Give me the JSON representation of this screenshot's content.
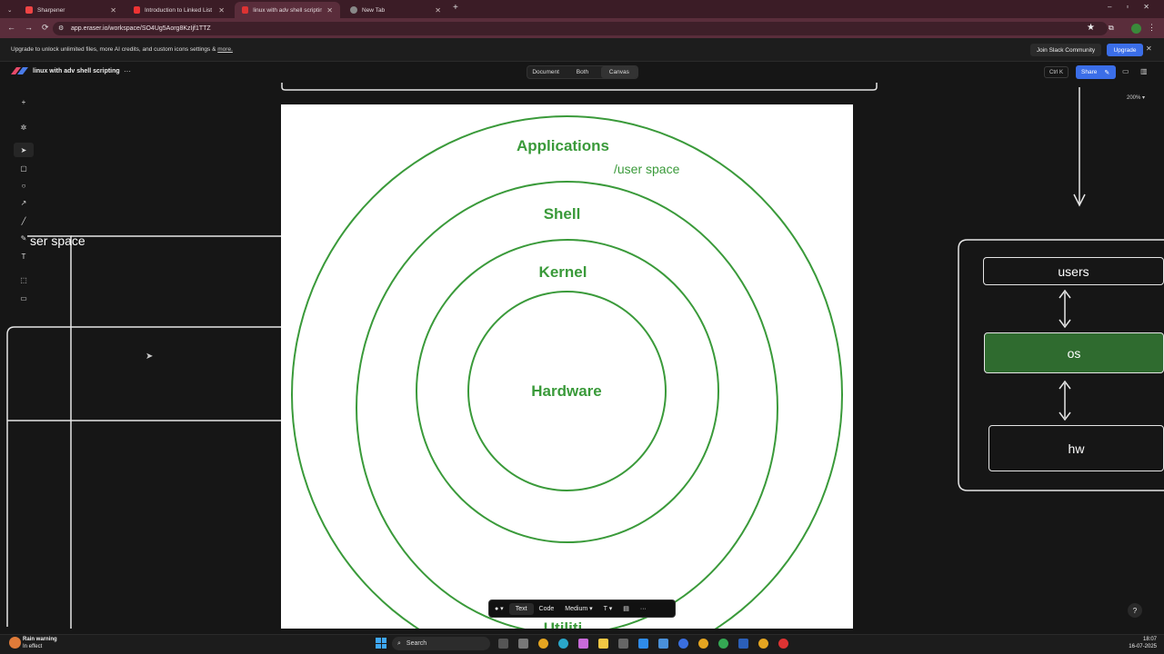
{
  "browser": {
    "tabs": [
      {
        "title": "Sharpener",
        "active": false
      },
      {
        "title": "Introduction to Linked List in D",
        "active": false
      },
      {
        "title": "linux with adv shell scripting -",
        "active": true
      },
      {
        "title": "New Tab",
        "active": false
      }
    ],
    "url": "app.eraser.io/workspace/SO4Ug5Aorg8KzIjf1TTZ"
  },
  "banner": {
    "text": "Upgrade to unlock unlimited files, more AI credits, and custom icons settings &",
    "link": "more.",
    "slack_label": "Join Slack Community",
    "upgrade_label": "Upgrade"
  },
  "app": {
    "doc_title": "linux with adv shell scripting",
    "view_modes": [
      "Document",
      "Both",
      "Canvas"
    ],
    "active_view": "Canvas",
    "shortcut_label": "Ctrl K",
    "share_label": "Share",
    "zoom": "200%"
  },
  "canvas": {
    "user_space_partial": "ser space",
    "image_labels": {
      "applications": "Applications",
      "user_space": "/user space",
      "shell": "Shell",
      "kernel": "Kernel",
      "hardware": "Hardware",
      "utilities_partial": "Utiliti"
    },
    "diagram": {
      "users": "users",
      "os": "os",
      "hw": "hw"
    }
  },
  "format_toolbar": {
    "text": "Text",
    "code": "Code",
    "size": "Medium ▾",
    "font": "T ▾",
    "more": "···"
  },
  "taskbar": {
    "weather_title": "Rain warning",
    "weather_sub": "In effect",
    "search_placeholder": "Search",
    "time": "18:07",
    "date": "16-07-2025"
  },
  "colors": {
    "ring_green": "#3a9a3a",
    "os_fill": "#2f6b2f",
    "accent_blue": "#3b6ee8"
  }
}
